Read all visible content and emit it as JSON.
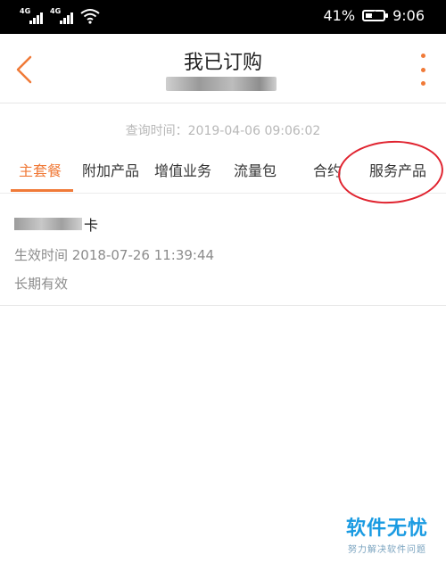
{
  "status_bar": {
    "sim1_label": "4G",
    "sim2_label": "4G",
    "battery_percent_text": "41%",
    "battery_level": 0.41,
    "time": "9:06"
  },
  "header": {
    "title": "我已订购",
    "back_icon": "chevron-left-icon",
    "more_icon": "more-vertical-icon",
    "accent_color": "#f07a38"
  },
  "query_time": "查询时间：2019-04-06 09:06:02",
  "tabs": [
    {
      "label": "主套餐",
      "active": true
    },
    {
      "label": "附加产品",
      "active": false
    },
    {
      "label": "增值业务",
      "active": false
    },
    {
      "label": "流量包",
      "active": false
    },
    {
      "label": "合约",
      "active": false
    },
    {
      "label": "服务产品",
      "active": false
    }
  ],
  "item": {
    "name_suffix": "卡",
    "effective_time": "生效时间 2018-07-26 11:39:44",
    "validity": "长期有效"
  },
  "watermark": {
    "title": "软件无忧",
    "subtitle": "努力解决软件问题"
  }
}
